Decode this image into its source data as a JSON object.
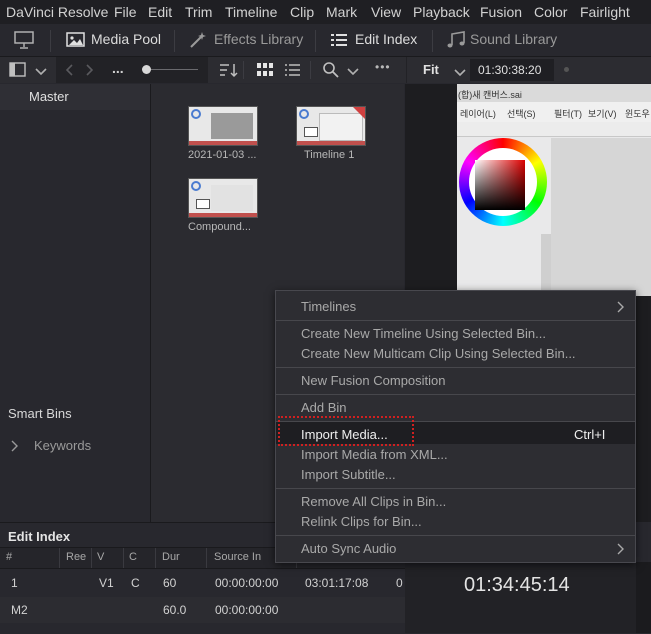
{
  "menu": [
    "DaVinci Resolve",
    "File",
    "Edit",
    "Trim",
    "Timeline",
    "Clip",
    "Mark",
    "View",
    "Playback",
    "Fusion",
    "Color",
    "Fairlight"
  ],
  "toolbar": {
    "media_pool": "Media Pool",
    "effects_library": "Effects Library",
    "edit_index": "Edit Index",
    "sound_library": "Sound Library"
  },
  "subbar": {
    "ellipsis": "...",
    "more": "•••",
    "fit": "Fit",
    "timecode": "01:30:38:20"
  },
  "bins": {
    "master": "Master",
    "smart_bins": "Smart Bins",
    "keywords": "Keywords"
  },
  "clips": [
    {
      "label": "2021-01-03 ..."
    },
    {
      "label": "Timeline 1"
    },
    {
      "label": "Compound..."
    }
  ],
  "viewer": {
    "app_title": "(합)새 캔버스.sai",
    "menu_items": [
      "레이어(L)",
      "선택(S)",
      "필터(T)",
      "보기(V)",
      "윈도우"
    ]
  },
  "edit_index": {
    "title": "Edit Index",
    "columns": [
      "#",
      "Ree",
      "V",
      "C",
      "Dur",
      "Source In"
    ],
    "rows": [
      {
        "num": "1",
        "reel": "",
        "v": "V1",
        "c": "C",
        "dur": "60",
        "source_in": "00:00:00:00",
        "extra": "03:01:17:08",
        "extra2": "0"
      },
      {
        "num": "M2",
        "reel": "",
        "v": "",
        "c": "",
        "dur": "60.0",
        "source_in": "00:00:00:00",
        "extra": "",
        "extra2": ""
      }
    ]
  },
  "record_timecode": "01:34:45:14",
  "context_menu": {
    "timelines": "Timelines",
    "create_timeline": "Create New Timeline Using Selected Bin...",
    "create_multicam": "Create New Multicam Clip Using Selected Bin...",
    "new_fusion": "New Fusion Composition",
    "add_bin": "Add Bin",
    "import_media": "Import Media...",
    "import_media_shortcut": "Ctrl+I",
    "import_from_xml": "Import Media from XML...",
    "import_subtitle": "Import Subtitle...",
    "remove_all": "Remove All Clips in Bin...",
    "relink": "Relink Clips for Bin...",
    "auto_sync": "Auto Sync Audio"
  },
  "colors": {
    "highlight": "#d02020",
    "accent_marker": "#c0504d"
  }
}
